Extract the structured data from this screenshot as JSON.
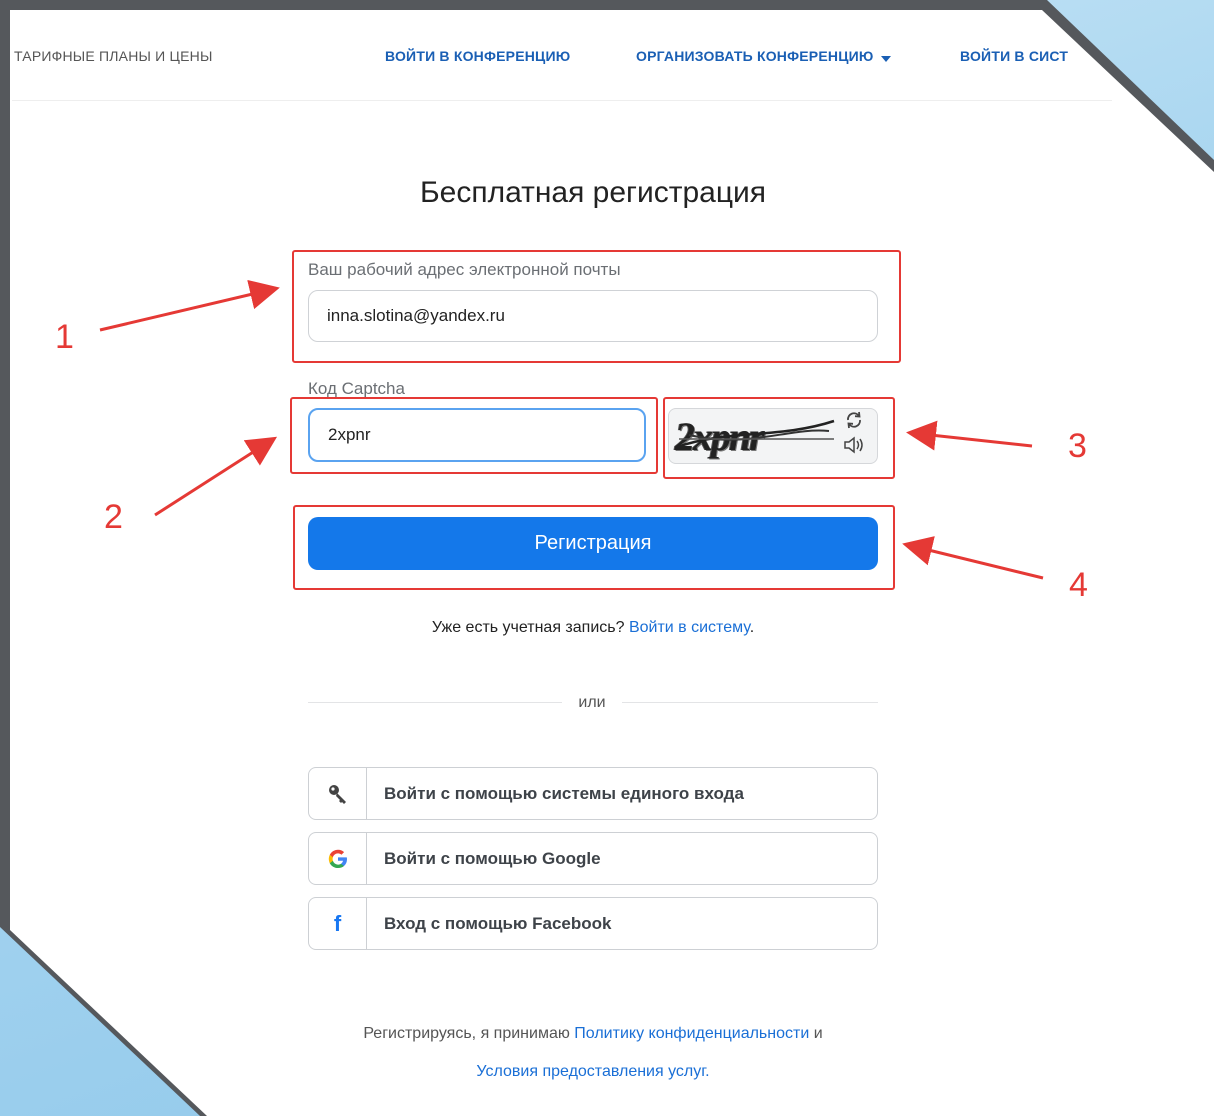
{
  "nav": {
    "plans": "ТАРИФНЫЕ ПЛАНЫ И ЦЕНЫ",
    "join": "ВОЙТИ В КОНФЕРЕНЦИЮ",
    "host": "ОРГАНИЗОВАТЬ КОНФЕРЕНЦИЮ",
    "signin": "ВОЙТИ В СИСТ"
  },
  "form": {
    "title": "Бесплатная регистрация",
    "email_label": "Ваш рабочий адрес электронной почты",
    "email_value": "inna.slotina@yandex.ru",
    "captcha_label": "Код Captcha",
    "captcha_value": "2xpnr",
    "captcha_image_text": "2xpnr",
    "register_label": "Регистрация",
    "have_account_text": "Уже есть учетная запись?",
    "signin_link": "Войти в систему",
    "signin_suffix": ".",
    "or_text": "или"
  },
  "social": {
    "sso": {
      "label": "Войти с помощью системы единого входа",
      "icon": "key-icon"
    },
    "google": {
      "label": "Войти с помощью Google",
      "icon": "google-icon"
    },
    "facebook": {
      "label": "Вход с помощью Facebook",
      "icon": "facebook-icon"
    }
  },
  "terms": {
    "prefix": "Регистрируясь, я принимаю",
    "privacy_link": "Политику конфиденциальности",
    "conjunction": "и",
    "terms_link": "Условия предоставления услуг."
  },
  "annotations": {
    "n1": "1",
    "n2": "2",
    "n3": "3",
    "n4": "4",
    "color": "#e53935"
  },
  "colors": {
    "accent": "#1478ea",
    "link": "#1a6fd6",
    "nav_link": "#1a5fb4"
  }
}
